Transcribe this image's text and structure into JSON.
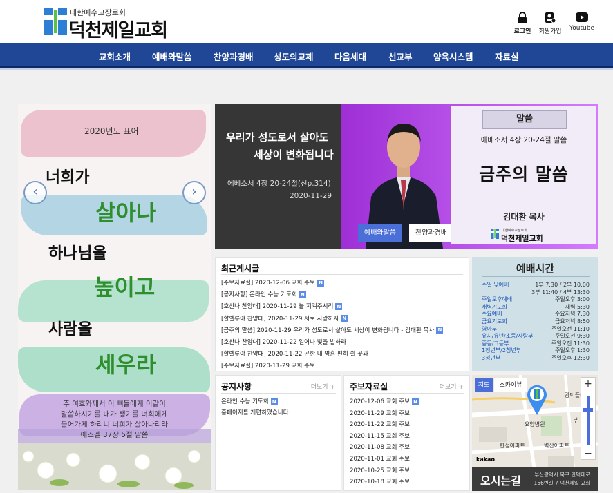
{
  "header": {
    "logo_sub": "대한예수교장로회",
    "logo_title": "덕천제일교회",
    "util": [
      {
        "label": "로그인",
        "icon": "lock-icon"
      },
      {
        "label": "회원가입",
        "icon": "user-add-icon"
      },
      {
        "label": "Youtube",
        "icon": "youtube-icon"
      }
    ]
  },
  "nav": [
    "교회소개",
    "예배와말씀",
    "찬양과경배",
    "성도의교제",
    "다음세대",
    "선교부",
    "양육시스템",
    "자료실"
  ],
  "motto": {
    "year": "2020년도 표어",
    "lines": [
      "너희가",
      "살아나",
      "하나님을",
      "높이고",
      "사람을",
      "세우라"
    ],
    "verse": [
      "주 여호와께서 이 뼈들에게 이같이",
      "말씀하시기를 내가 생기를 너희에게",
      "들어가게 하리니 너희가 살아나리라",
      "에스겔 37장 5절 말씀"
    ]
  },
  "hero": {
    "title": [
      "우리가 성도로서 살아도",
      "세상이 변화됩니다"
    ],
    "ref": "에베소서 4장 20-24절(신p.314)",
    "date": "2020-11-29",
    "tabs": [
      "예배와말씀",
      "찬양과경배"
    ],
    "badge": "말씀",
    "scripture": "에베소서 4장 20-24절 말씀",
    "series": "금주의 말씀",
    "pastor": "김대환 목사",
    "church_small": "덕천제일교회",
    "church_tiny": "대한예수교장로회"
  },
  "recent": {
    "title": "최근게시글",
    "posts": [
      {
        "text": "[주보자료실] 2020-12-06 교회 주보",
        "new": true
      },
      {
        "text": "[공지사항] 온라인 수능 기도회",
        "new": true
      },
      {
        "text": "[호산나 찬양대] 2020-11-29 늘 지켜주시리",
        "new": true
      },
      {
        "text": "[할렐루야 찬양대] 2020-11-29 서로 사랑하자",
        "new": true
      },
      {
        "text": "[금주의 말씀] 2020-11-29 우리가 성도로서 살아도 세상이 변화됩니다 - 김대환 목사",
        "new": true
      },
      {
        "text": "[호산나 찬양대] 2020-11-22 일어나 빛을 발하라",
        "new": false
      },
      {
        "text": "[할렐루야 찬양대] 2020-11-22 곤한 내 영혼 편히 쉴 곳과",
        "new": false
      },
      {
        "text": "[주보자료실] 2020-11-29 교회 주보",
        "new": false
      }
    ]
  },
  "worship": {
    "title": "예배시간",
    "rows": [
      {
        "name": "주일 낮예배",
        "time": "1부 7:30 / 2부 10:00"
      },
      {
        "name": "",
        "time": "3부 11:40 / 4부 13:30"
      },
      {
        "name": "주일오후예배",
        "time": "주일오후 3:00"
      },
      {
        "name": "새벽기도회",
        "time": "새벽 5:30"
      },
      {
        "name": "수요예배",
        "time": "수요저녁 7:30"
      },
      {
        "name": "금요기도회",
        "time": "금요저녁 8:50"
      },
      {
        "name": "영아부",
        "time": "주일오전 11:10"
      },
      {
        "name": "유치/유년/초등/사랑부",
        "time": "주일오전 9:30"
      },
      {
        "name": "중등/고등부",
        "time": "주일오전 11:30"
      },
      {
        "name": "1청년부/2청년부",
        "time": "주일오후 1:30"
      },
      {
        "name": "3청년부",
        "time": "주일오후 12:30"
      }
    ]
  },
  "notice": {
    "title": "공지사항",
    "more": "더보기 +",
    "posts": [
      {
        "text": "온라인 수능 기도회",
        "new": true
      },
      {
        "text": "홈페이지를 개편하였습니다",
        "new": false
      }
    ]
  },
  "bulletin": {
    "title": "주보자료실",
    "more": "더보기 +",
    "posts": [
      {
        "text": "2020-12-06 교회 주보",
        "new": true
      },
      {
        "text": "2020-11-29 교회 주보",
        "new": false
      },
      {
        "text": "2020-11-22 교회 주보",
        "new": false
      },
      {
        "text": "2020-11-15 교회 주보",
        "new": false
      },
      {
        "text": "2020-11-08 교회 주보",
        "new": false
      },
      {
        "text": "2020-11-01 교회 주보",
        "new": false
      },
      {
        "text": "2020-10-25 교회 주보",
        "new": false
      },
      {
        "text": "2020-10-18 교회 주보",
        "new": false
      }
    ]
  },
  "map": {
    "tabs": [
      "지도",
      "스카이뷰"
    ],
    "labels": [
      "광덕플러",
      "요양병원",
      "한성아파트",
      "벽산아파트",
      "부"
    ],
    "kakao": "kakao",
    "title": "오시는길",
    "address": [
      "부산광역시 북구 만덕대로",
      "156번길 7 덕천제일 교회"
    ]
  },
  "colors": {
    "nav": "#1f4796",
    "accent": "#4a6fd8",
    "hero_purple": "#9e2fd6",
    "green": "#3a9a3a"
  }
}
